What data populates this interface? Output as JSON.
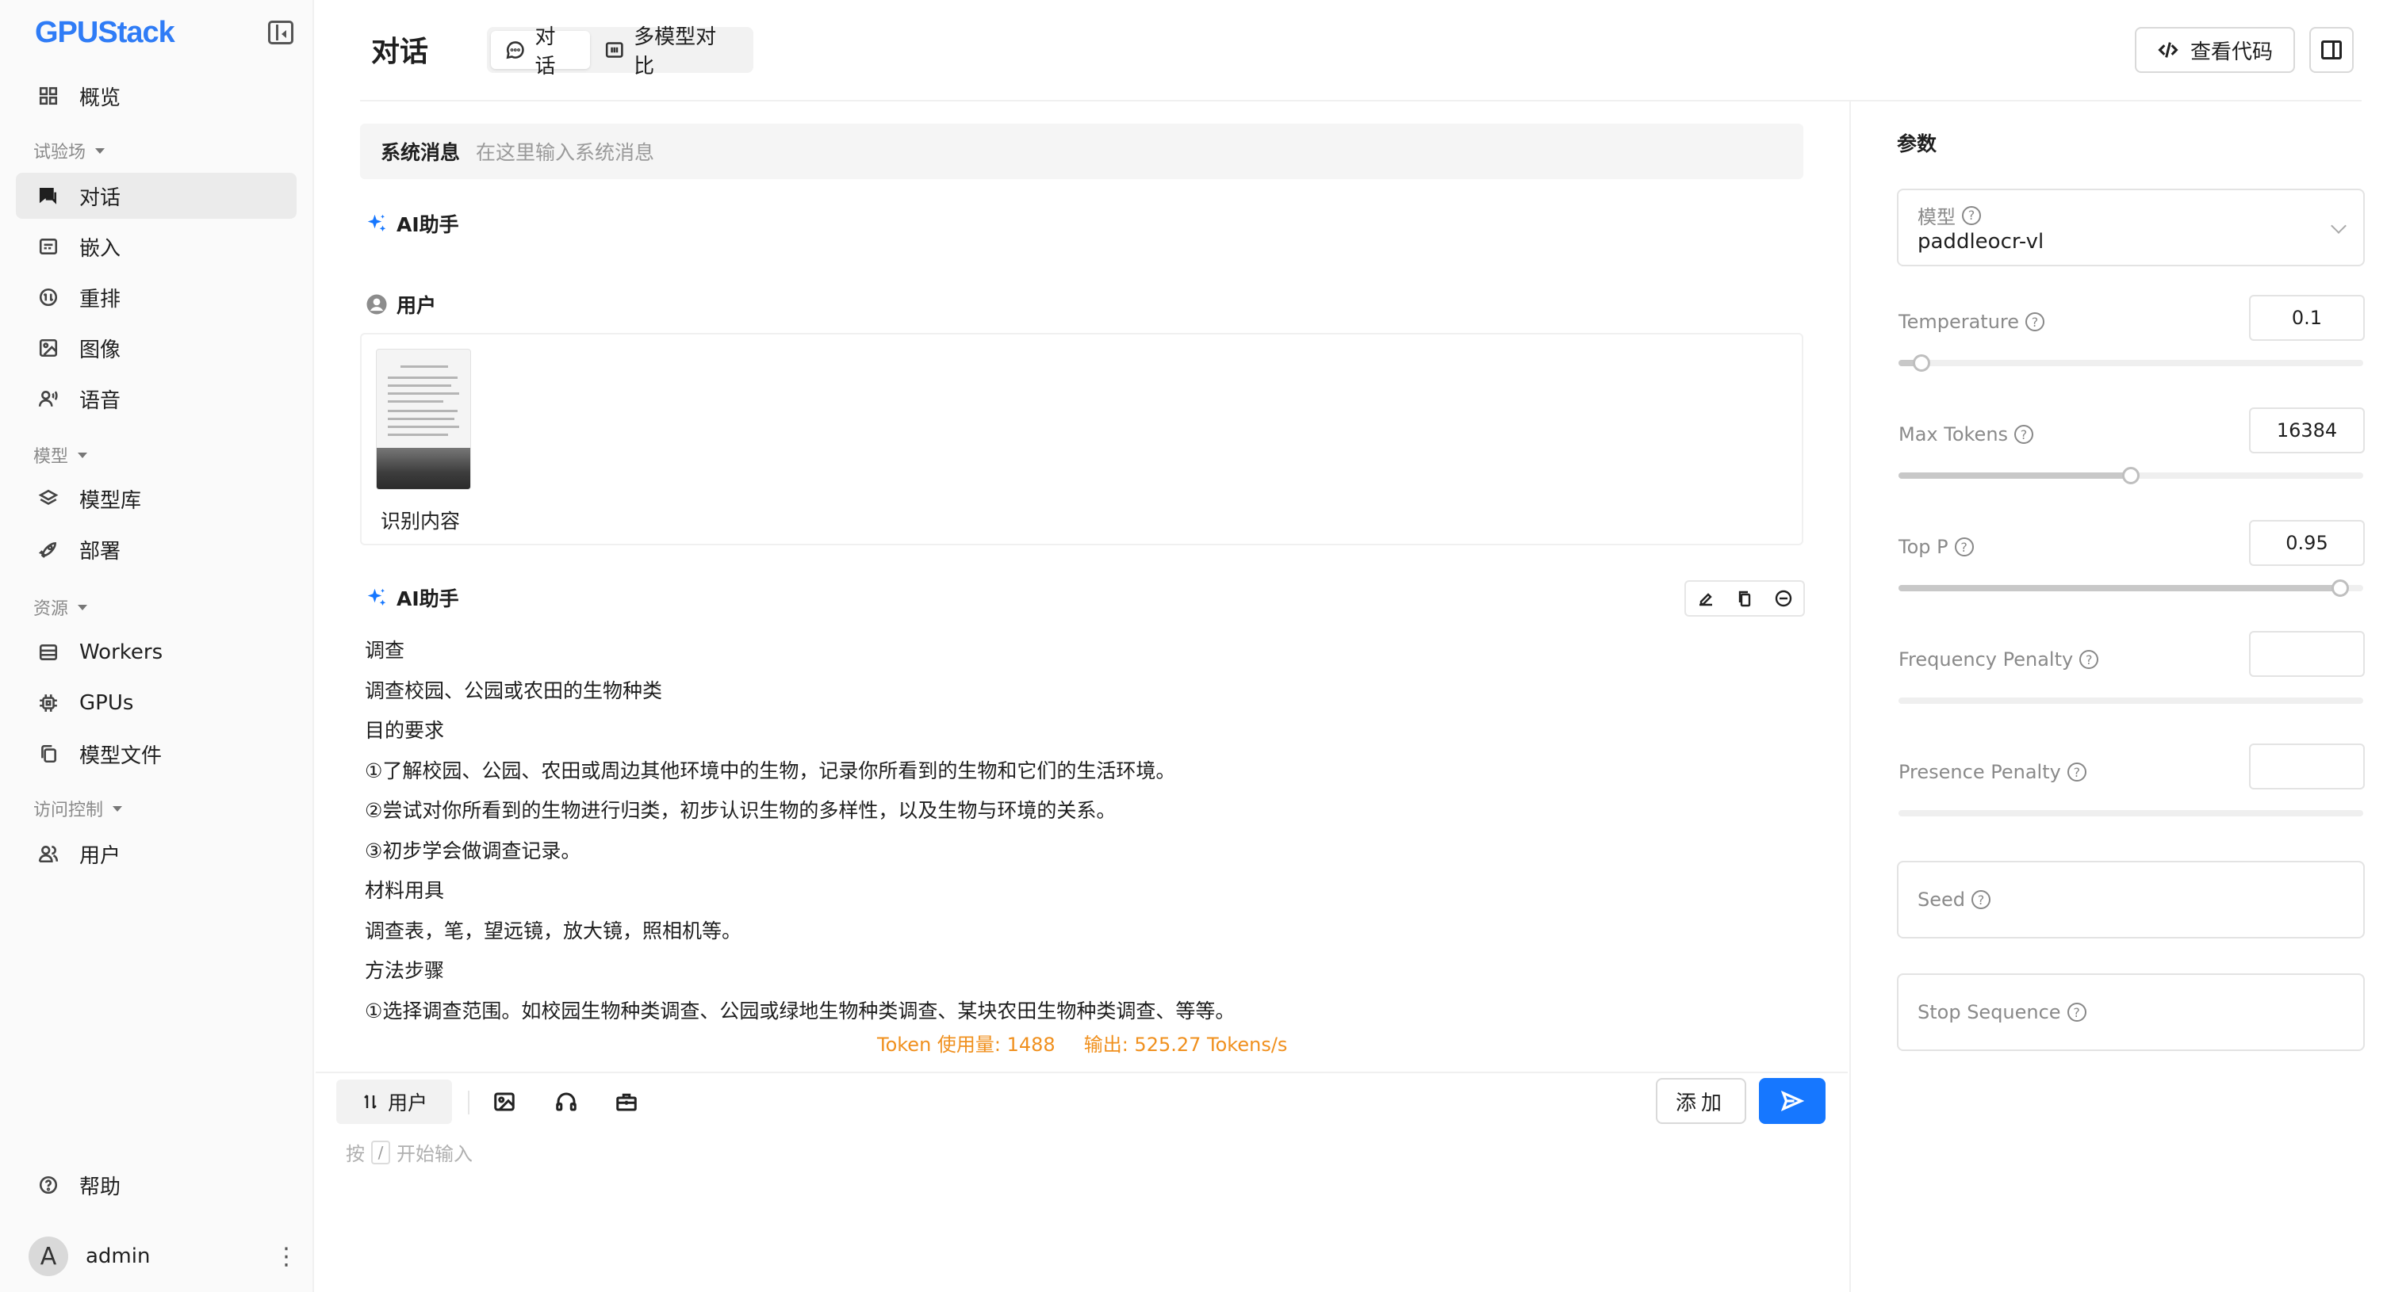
{
  "brand": "GPUStack",
  "sidebar": {
    "items": [
      {
        "label": "概览",
        "icon": "grid-icon"
      },
      {
        "label": "对话",
        "icon": "chat-icon"
      },
      {
        "label": "嵌入",
        "icon": "embed-icon"
      },
      {
        "label": "重排",
        "icon": "rerank-icon"
      },
      {
        "label": "图像",
        "icon": "image-icon"
      },
      {
        "label": "语音",
        "icon": "voice-icon"
      },
      {
        "label": "模型库",
        "icon": "layers-icon"
      },
      {
        "label": "部署",
        "icon": "rocket-icon"
      },
      {
        "label": "Workers",
        "icon": "server-icon"
      },
      {
        "label": "GPUs",
        "icon": "chip-icon"
      },
      {
        "label": "模型文件",
        "icon": "files-icon"
      },
      {
        "label": "用户",
        "icon": "users-icon"
      },
      {
        "label": "帮助",
        "icon": "help-icon"
      }
    ],
    "groups": {
      "playground": "试验场",
      "models": "模型",
      "resources": "资源",
      "access": "访问控制"
    },
    "active_item": "对话",
    "user": {
      "avatar_letter": "A",
      "name": "admin"
    }
  },
  "header": {
    "title": "对话",
    "tabs": [
      {
        "label": "对话",
        "active": true
      },
      {
        "label": "多模型对比",
        "active": false
      }
    ],
    "view_code_label": "查看代码"
  },
  "chat": {
    "system_label": "系统消息",
    "system_placeholder": "在这里输入系统消息",
    "assistant_role": "AI助手",
    "user_role": "用户",
    "user_message_text": "识别内容",
    "answer_lines": [
      "调查",
      "调查校园、公园或农田的生物种类",
      "目的要求",
      "①了解校园、公园、农田或周边其他环境中的生物，记录你所看到的生物和它们的生活环境。",
      "②尝试对你所看到的生物进行归类，初步认识生物的多样性，以及生物与环境的关系。",
      "③初步学会做调查记录。",
      "材料用具",
      "调查表，笔，望远镜，放大镜，照相机等。",
      "方法步骤",
      "①选择调查范围。如校园生物种类调查、公园或绿地生物种类调查、某块农田生物种类调查、等等。"
    ],
    "token_usage": "Token 使用量: 1488",
    "output_speed": "输出: 525.27 Tokens/s"
  },
  "composer": {
    "role_label": "用户",
    "add_label": "添加",
    "hint_prefix": "按",
    "hint_key": "/",
    "hint_suffix": "开始输入"
  },
  "params": {
    "title": "参数",
    "model_label": "模型",
    "model_value": "paddleocr-vl",
    "temperature": {
      "label": "Temperature",
      "value": "0.1",
      "fraction": 0.05
    },
    "max_tokens": {
      "label": "Max Tokens",
      "value": "16384",
      "fraction": 0.5
    },
    "top_p": {
      "label": "Top P",
      "value": "0.95",
      "fraction": 0.95
    },
    "frequency_penalty": {
      "label": "Frequency Penalty",
      "value": ""
    },
    "presence_penalty": {
      "label": "Presence Penalty",
      "value": ""
    },
    "seed_label": "Seed",
    "stop_sequence_label": "Stop Sequence"
  },
  "colors": {
    "accent": "#1677ff",
    "token_stats": "#f0901e",
    "active_nav_bg": "#ebebeb"
  }
}
